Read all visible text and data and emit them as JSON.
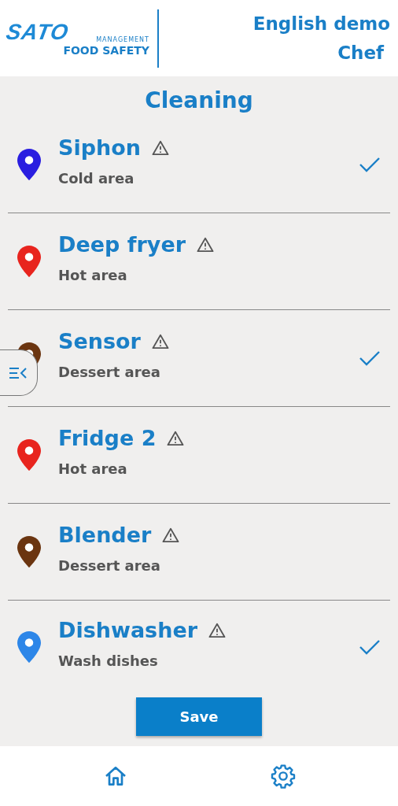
{
  "header": {
    "logo": {
      "brand": "SATO",
      "tagline": "MANAGEMENT",
      "product": "FOOD SAFETY"
    },
    "account": "English demo",
    "role": "Chef"
  },
  "title": "Cleaning",
  "items": [
    {
      "name": "Siphon",
      "area": "Cold area",
      "color": "#2a1ee0",
      "checked": true
    },
    {
      "name": "Deep fryer",
      "area": "Hot area",
      "color": "#e8241e",
      "checked": false
    },
    {
      "name": "Sensor",
      "area": "Dessert area",
      "color": "#6b3510",
      "checked": true
    },
    {
      "name": "Fridge 2",
      "area": "Hot area",
      "color": "#e8241e",
      "checked": false
    },
    {
      "name": "Blender",
      "area": "Dessert area",
      "color": "#6b3510",
      "checked": false
    },
    {
      "name": "Dishwasher",
      "area": "Wash dishes",
      "color": "#2d86e8",
      "checked": true
    }
  ],
  "save_button": "Save"
}
